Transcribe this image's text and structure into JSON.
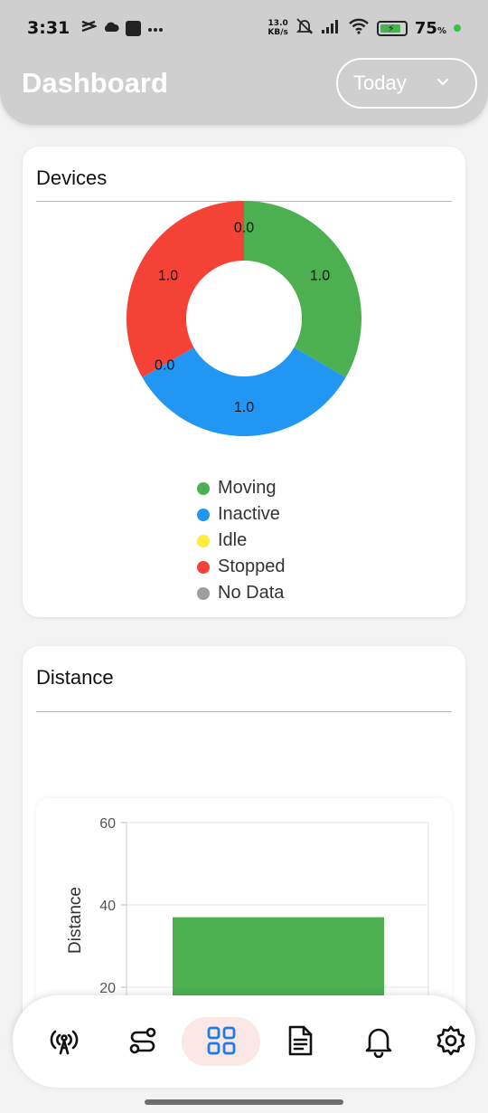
{
  "status_bar": {
    "time": "3:31",
    "net_speed_value": "13.0",
    "net_speed_unit": "KB/s",
    "battery_percent": "75",
    "battery_unit": "%"
  },
  "header": {
    "title": "Dashboard",
    "period": "Today"
  },
  "devices": {
    "title": "Devices",
    "slice_labels": [
      "1.0",
      "1.0",
      "1.0",
      "0.0",
      "0.0"
    ],
    "legend": [
      {
        "label": "Moving",
        "color": "#4caf50"
      },
      {
        "label": "Inactive",
        "color": "#2196f3"
      },
      {
        "label": "Idle",
        "color": "#ffeb3b"
      },
      {
        "label": "Stopped",
        "color": "#f44336"
      },
      {
        "label": "No Data",
        "color": "#9e9e9e"
      }
    ]
  },
  "distance": {
    "title": "Distance"
  },
  "chart_data": [
    {
      "type": "pie",
      "title": "Devices",
      "donut": true,
      "categories": [
        "Moving",
        "Inactive",
        "Idle",
        "Stopped",
        "No Data"
      ],
      "values": [
        1.0,
        1.0,
        0.0,
        1.0,
        0.0
      ],
      "colors": [
        "#4caf50",
        "#2196f3",
        "#ffeb3b",
        "#f44336",
        "#9e9e9e"
      ],
      "legend": "bottom"
    },
    {
      "type": "bar",
      "title": "Distance",
      "categories": [
        ""
      ],
      "values": [
        37
      ],
      "color": "#4caf50",
      "ylabel": "Distance",
      "ylim": [
        0,
        60
      ],
      "yticks": [
        "20",
        "40",
        "60"
      ],
      "grid": true
    }
  ],
  "bottom_nav": [
    {
      "name": "live-tracking",
      "icon": "broadcast-tower-icon",
      "active": false
    },
    {
      "name": "routes",
      "icon": "route-icon",
      "active": false
    },
    {
      "name": "dashboard",
      "icon": "dashboard-grid-icon",
      "active": true
    },
    {
      "name": "reports",
      "icon": "document-icon",
      "active": false
    },
    {
      "name": "notifications",
      "icon": "bell-icon",
      "active": false
    },
    {
      "name": "settings",
      "icon": "gear-icon",
      "active": false
    }
  ],
  "colors": {
    "accent": "#1e7be8",
    "header_bg": "#cfcfcf",
    "active_nav_bg": "#fbe7e5"
  }
}
